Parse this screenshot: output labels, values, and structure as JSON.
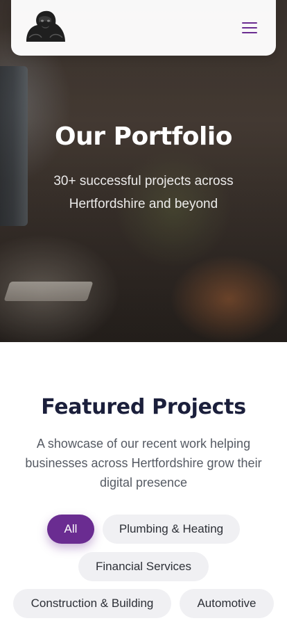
{
  "hero": {
    "title": "Our Portfolio",
    "subtitle": "30+ successful projects across Hertfordshire and beyond"
  },
  "header": {
    "logo_icon": "gorilla-logo-icon",
    "menu_icon": "hamburger-menu-icon"
  },
  "featured": {
    "title": "Featured Projects",
    "description": "A showcase of our recent work helping businesses across Hertfordshire grow their digital presence"
  },
  "filters": {
    "items": [
      {
        "label": "All",
        "active": true
      },
      {
        "label": "Plumbing & Heating",
        "active": false
      },
      {
        "label": "Financial Services",
        "active": false
      },
      {
        "label": "Construction & Building",
        "active": false
      },
      {
        "label": "Automotive",
        "active": false
      }
    ]
  },
  "colors": {
    "accent": "#6a2c91",
    "heading": "#1b1f3b",
    "pill_bg": "#f0f0f3"
  }
}
